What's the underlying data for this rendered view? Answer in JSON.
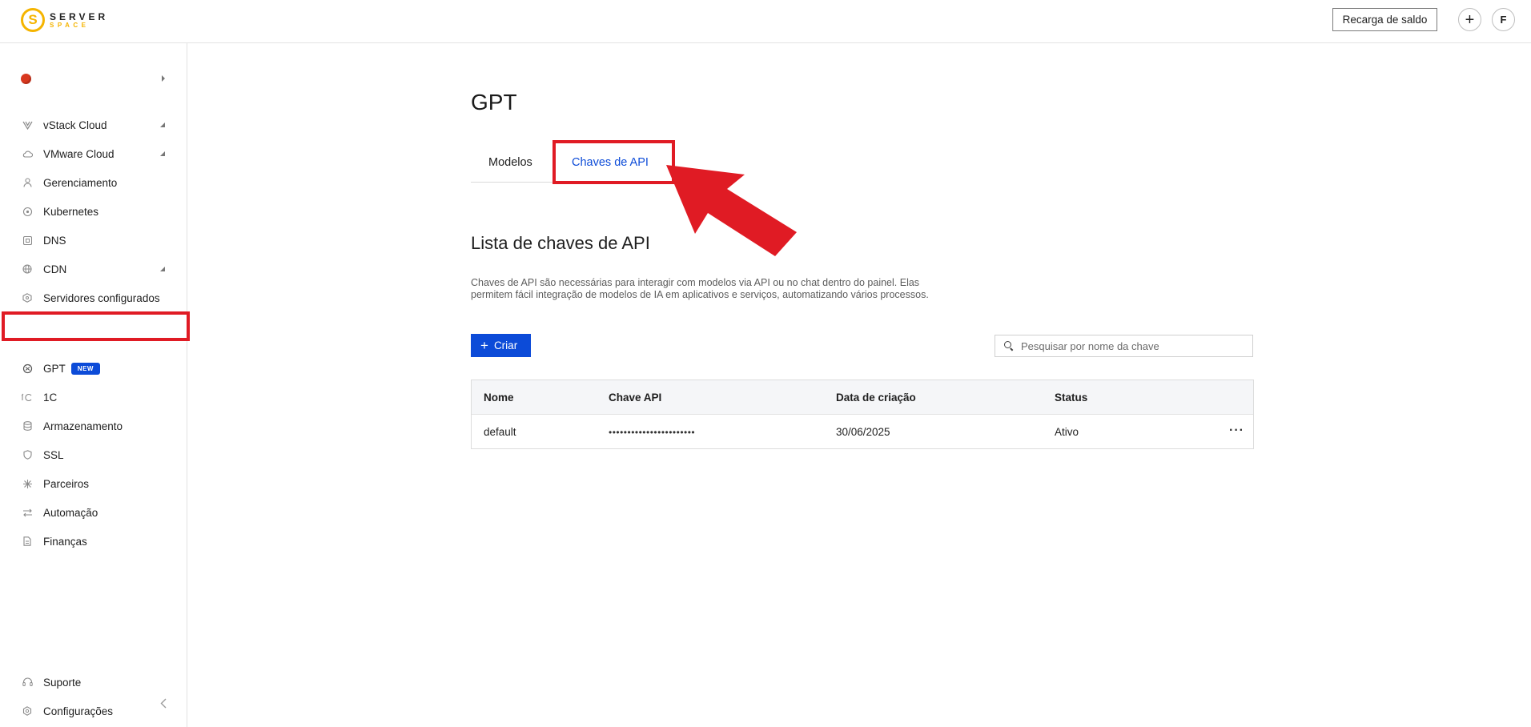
{
  "header": {
    "logo_mark": "S",
    "logo_top": "SERVER",
    "logo_bottom": "SPACE",
    "topup_label": "Recarga de saldo",
    "plus_label": "+",
    "avatar_initial": "F"
  },
  "sidebar": {
    "items": [
      {
        "label": "vStack Cloud",
        "icon": "vstack-icon"
      },
      {
        "label": "VMware Cloud",
        "icon": "cloud-icon"
      },
      {
        "label": "Gerenciamento",
        "icon": "user-icon"
      },
      {
        "label": "Kubernetes",
        "icon": "kubernetes-icon"
      },
      {
        "label": "DNS",
        "icon": "dns-icon"
      },
      {
        "label": "CDN",
        "icon": "globe-icon"
      },
      {
        "label": "Servidores configurados",
        "icon": "server-icon"
      },
      {
        "label": "GPT",
        "icon": "gpt-icon",
        "badge": "NEW"
      },
      {
        "label": "1C",
        "icon": "onec-icon"
      },
      {
        "label": "Armazenamento",
        "icon": "storage-icon"
      },
      {
        "label": "SSL",
        "icon": "shield-icon"
      },
      {
        "label": "Parceiros",
        "icon": "partners-icon"
      },
      {
        "label": "Automação",
        "icon": "automation-icon"
      },
      {
        "label": "Finanças",
        "icon": "document-icon"
      }
    ],
    "bottom_items": [
      {
        "label": "Suporte",
        "icon": "headset-icon"
      },
      {
        "label": "Configurações",
        "icon": "gear-icon"
      }
    ]
  },
  "main": {
    "title": "GPT",
    "tabs": [
      {
        "label": "Modelos"
      },
      {
        "label": "Chaves de API"
      }
    ],
    "section_title": "Lista de chaves de API",
    "description": "Chaves de API são necessárias para interagir com modelos via API ou no chat dentro do painel. Elas permitem fácil integração de modelos de IA em aplicativos e serviços, automatizando vários processos.",
    "create_label": "Criar",
    "search_placeholder": "Pesquisar por nome da chave",
    "table": {
      "columns": [
        "Nome",
        "Chave API",
        "Data de criação",
        "Status"
      ],
      "rows": [
        {
          "name": "default",
          "key": "•••••••••••••••••••••••",
          "created": "30/06/2025",
          "status": "Ativo",
          "menu": "···"
        }
      ]
    }
  },
  "colors": {
    "accent": "#0c4bd8",
    "logo": "#f5b400",
    "highlight": "#e01b24"
  }
}
